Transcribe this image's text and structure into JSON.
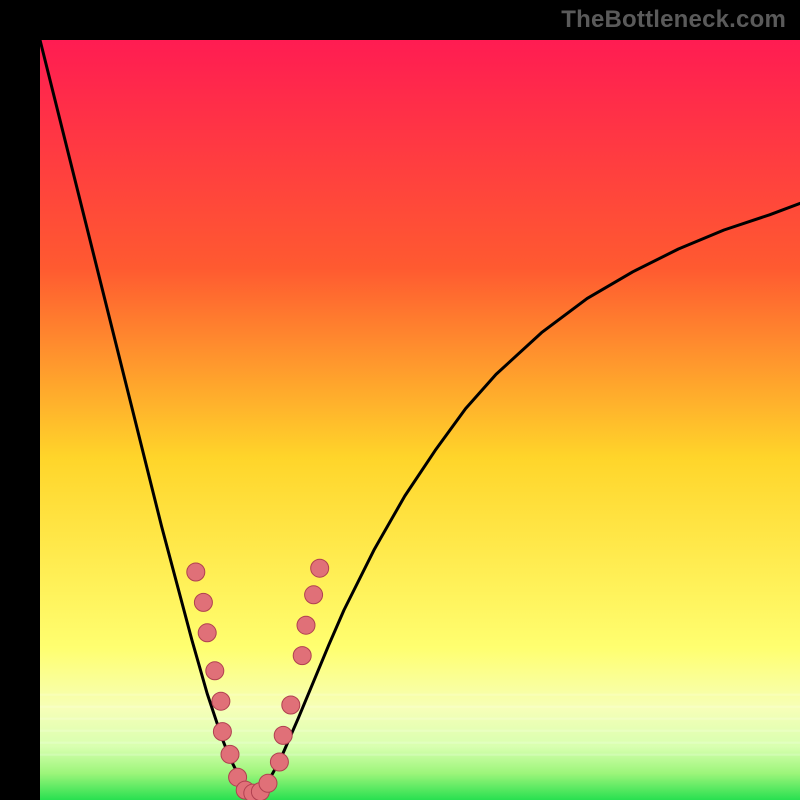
{
  "watermark": "TheBottleneck.com",
  "colors": {
    "bg": "#000000",
    "gradient_top": "#ff1c52",
    "gradient_mid1": "#ff6a2a",
    "gradient_mid2": "#ffd52a",
    "gradient_mid3": "#ffff66",
    "gradient_mid4": "#eaffb0",
    "gradient_bottom": "#28e050",
    "curve": "#000000",
    "marker_fill": "#e07078",
    "marker_stroke": "#b04050"
  },
  "chart_data": {
    "type": "line",
    "title": "",
    "xlabel": "",
    "ylabel": "",
    "xlim": [
      0,
      100
    ],
    "ylim": [
      0,
      100
    ],
    "x_optimum": 28,
    "curve": {
      "x": [
        0,
        2,
        4,
        6,
        8,
        10,
        12,
        14,
        16,
        18,
        20,
        22,
        24,
        25,
        26,
        27,
        28,
        29,
        30,
        31,
        32,
        34,
        36,
        38,
        40,
        44,
        48,
        52,
        56,
        60,
        66,
        72,
        78,
        84,
        90,
        96,
        100
      ],
      "y": [
        100,
        92,
        84,
        76,
        68,
        60,
        52,
        44,
        36,
        28.5,
        21,
        14,
        8,
        5.5,
        3.5,
        1.8,
        0.8,
        1.2,
        2.4,
        4.2,
        6.2,
        10.8,
        15.6,
        20.4,
        25,
        33,
        40,
        46,
        51.5,
        56,
        61.5,
        66,
        69.5,
        72.5,
        75,
        77,
        78.5
      ]
    },
    "markers": [
      {
        "x": 20.5,
        "y": 30.0
      },
      {
        "x": 21.5,
        "y": 26.0
      },
      {
        "x": 22.0,
        "y": 22.0
      },
      {
        "x": 23.0,
        "y": 17.0
      },
      {
        "x": 23.8,
        "y": 13.0
      },
      {
        "x": 24.0,
        "y": 9.0
      },
      {
        "x": 25.0,
        "y": 6.0
      },
      {
        "x": 26.0,
        "y": 3.0
      },
      {
        "x": 27.0,
        "y": 1.3
      },
      {
        "x": 28.0,
        "y": 0.9
      },
      {
        "x": 29.0,
        "y": 1.1
      },
      {
        "x": 30.0,
        "y": 2.2
      },
      {
        "x": 31.5,
        "y": 5.0
      },
      {
        "x": 32.0,
        "y": 8.5
      },
      {
        "x": 33.0,
        "y": 12.5
      },
      {
        "x": 34.5,
        "y": 19.0
      },
      {
        "x": 35.0,
        "y": 23.0
      },
      {
        "x": 36.0,
        "y": 27.0
      },
      {
        "x": 36.8,
        "y": 30.5
      }
    ]
  }
}
